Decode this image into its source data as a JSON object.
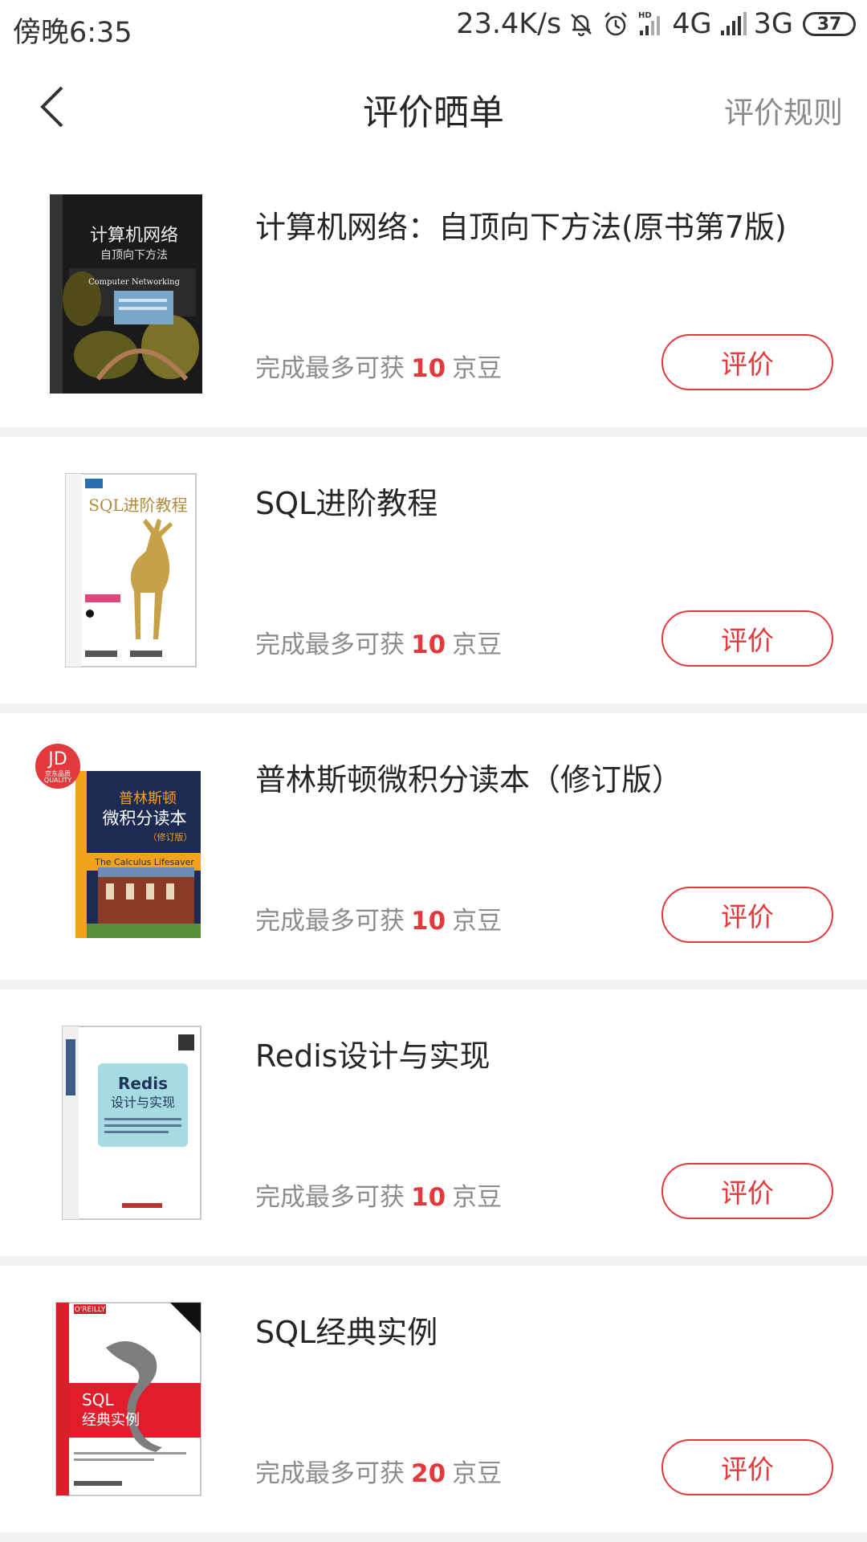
{
  "status_bar": {
    "time": "傍晚6:35",
    "net_speed": "23.4K/s",
    "network_4g": "4G",
    "network_3g": "3G",
    "battery": "37"
  },
  "nav": {
    "title": "评价晒单",
    "rules_link": "评价规则"
  },
  "reward": {
    "prefix": "完成最多可获",
    "suffix": "京豆"
  },
  "items": [
    {
      "title": "计算机网络：自顶向下方法(原书第7版)",
      "beans": "10",
      "button": "评价",
      "cover": {
        "lines": [
          "计算机网络",
          "自顶向下方法"
        ],
        "en": "Computer Networking"
      }
    },
    {
      "title": "SQL进阶教程",
      "beans": "10",
      "button": "评价",
      "cover": {
        "lines": [
          "SQL进阶教程"
        ]
      }
    },
    {
      "title": "普林斯顿微积分读本（修订版）",
      "beans": "10",
      "button": "评价",
      "cover": {
        "lines": [
          "普林斯顿",
          "微积分读本",
          "（修订版）"
        ],
        "en": "The Calculus Lifesaver"
      },
      "badge": {
        "main": "JD",
        "sub": "京东品质 QUALITY"
      }
    },
    {
      "title": "Redis设计与实现",
      "beans": "10",
      "button": "评价",
      "cover": {
        "lines": [
          "Redis",
          "设计与实现"
        ]
      }
    },
    {
      "title": "SQL经典实例",
      "beans": "20",
      "button": "评价",
      "cover": {
        "lines": [
          "SQL",
          "经典实例"
        ],
        "brand": "O'REILLY"
      }
    }
  ],
  "colors": {
    "accent": "#e4393c",
    "muted": "#8c8c8c"
  }
}
